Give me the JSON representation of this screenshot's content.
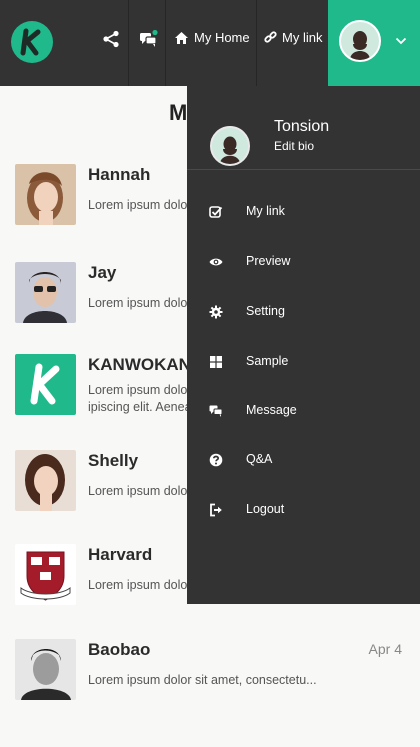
{
  "header": {
    "logo_letter": "K",
    "my_home_label": "My Home",
    "my_link_label": "My link",
    "accent_color": "#20b98c",
    "bar_color": "#333333",
    "icons": [
      "share-icon",
      "chat-icon",
      "home-icon",
      "link-icon",
      "chevron-down-icon"
    ]
  },
  "page": {
    "title_fragment": "M"
  },
  "messages": [
    {
      "name": "Hannah",
      "preview": "Lorem ipsum dolor sit amet, consectetu..."
    },
    {
      "name": "Jay",
      "preview": "Lorem ipsum dolor sit amet, consectetu..."
    },
    {
      "name": "KANWOKAN",
      "preview_line1": "Lorem ipsum dolor sit amet, consectetur ad",
      "preview_line2": "ipiscing elit. Aenean euismod bibendum."
    },
    {
      "name": "Shelly",
      "preview": "Lorem ipsum dolor sit amet, consectetu..."
    },
    {
      "name": "Harvard",
      "preview": "Lorem ipsum dolor sit amet, consectetu..."
    },
    {
      "name": "Baobao",
      "preview": "Lorem ipsum dolor sit amet, consectetu...",
      "date": "Apr 4"
    }
  ],
  "menu": {
    "user_name": "Tonsion",
    "edit_bio": "Edit bio",
    "items": [
      {
        "label": "My link",
        "icon": "check-square-icon"
      },
      {
        "label": "Preview",
        "icon": "eye-icon"
      },
      {
        "label": "Setting",
        "icon": "gear-icon"
      },
      {
        "label": "Sample",
        "icon": "grid-icon"
      },
      {
        "label": "Message",
        "icon": "chat-icon"
      },
      {
        "label": "Q&A",
        "icon": "question-icon"
      },
      {
        "label": "Logout",
        "icon": "logout-icon"
      }
    ]
  }
}
